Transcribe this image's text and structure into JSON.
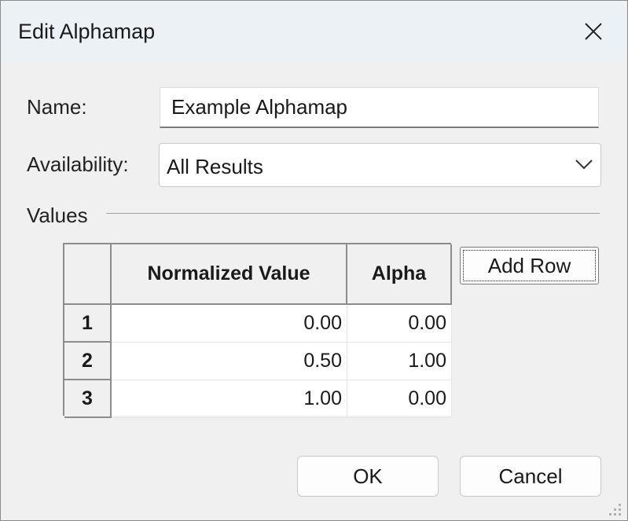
{
  "window": {
    "title": "Edit Alphamap"
  },
  "form": {
    "name_label": "Name:",
    "name_value": "Example Alphamap",
    "availability_label": "Availability:",
    "availability_value": "All Results",
    "values_label": "Values"
  },
  "table": {
    "columns": [
      "Normalized Value",
      "Alpha"
    ],
    "rows": [
      {
        "index": "1",
        "normalized": "0.00",
        "alpha": "0.00"
      },
      {
        "index": "2",
        "normalized": "0.50",
        "alpha": "1.00"
      },
      {
        "index": "3",
        "normalized": "1.00",
        "alpha": "0.00"
      }
    ]
  },
  "buttons": {
    "add_row": "Add Row",
    "ok": "OK",
    "cancel": "Cancel"
  },
  "icons": {
    "close": "close-icon",
    "dropdown": "chevron-down-icon",
    "resize": "resize-grip-icon"
  }
}
